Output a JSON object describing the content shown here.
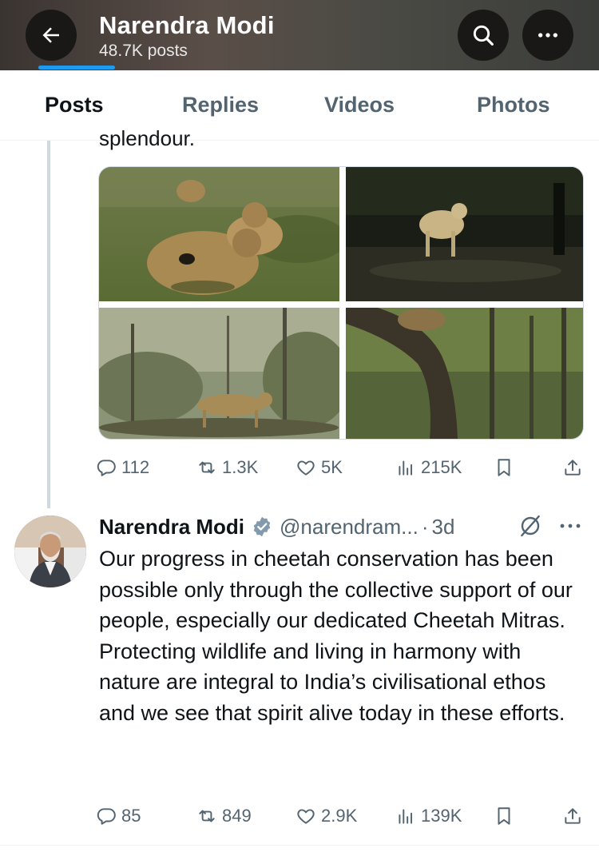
{
  "header": {
    "title": "Narendra Modi",
    "subtitle": "48.7K posts",
    "gradient": [
      "#3a3431",
      "#5a4e48",
      "#3b3d3a"
    ]
  },
  "tabs": [
    {
      "label": "Posts",
      "active": true
    },
    {
      "label": "Replies",
      "active": false
    },
    {
      "label": "Videos",
      "active": false
    },
    {
      "label": "Photos",
      "active": false
    }
  ],
  "accent_color": "#1d9bf0",
  "tweet1": {
    "truncated_text": "splendour.",
    "media_alt": [
      "cheetahs-resting-on-grass",
      "cheetah-by-water-at-night",
      "cheetah-in-forest",
      "cheetah-climbing-tree"
    ],
    "stats": {
      "replies": "112",
      "reposts": "1.3K",
      "likes": "5K",
      "views": "215K"
    }
  },
  "tweet2": {
    "name": "Narendra Modi",
    "handle": "@narendram...",
    "dot": "·",
    "time": "3d",
    "text": "Our progress in cheetah conservation has been possible only through the collective support of our people, especially our dedicated Cheetah Mitras. Protecting wildlife and living in harmony with nature are integral to India’s civilisational ethos and we see that spirit alive today in these efforts.",
    "stats": {
      "replies": "85",
      "reposts": "849",
      "likes": "2.9K",
      "views": "139K"
    }
  }
}
